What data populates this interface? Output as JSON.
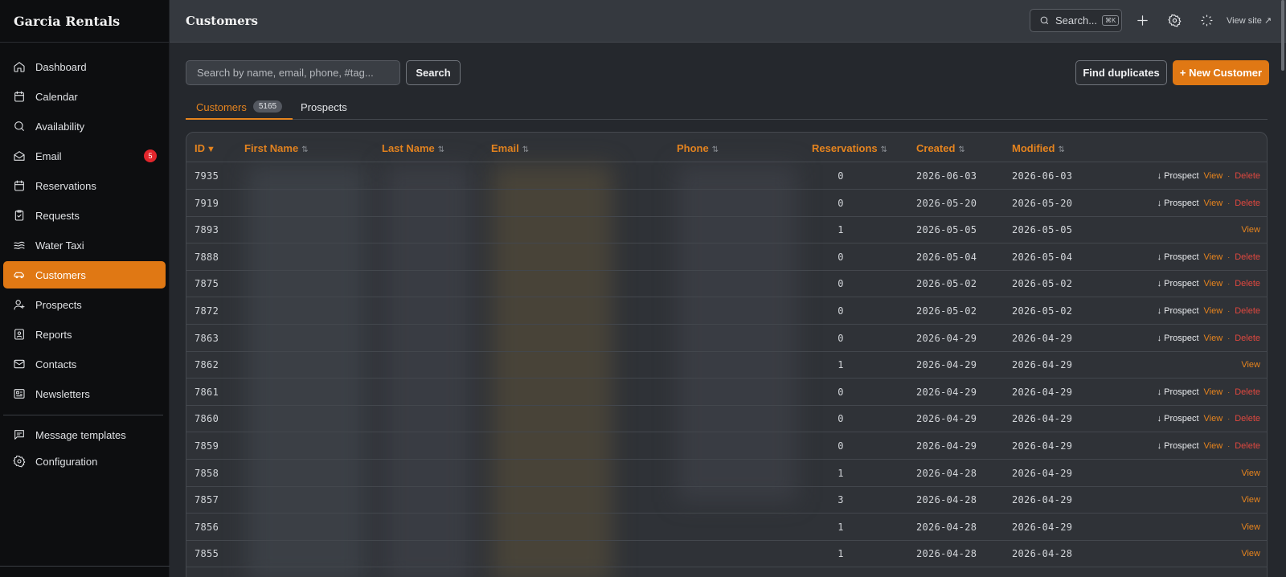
{
  "brand": "Garcia Rentals",
  "nav": {
    "items": [
      {
        "label": "Dashboard",
        "icon": "home-icon"
      },
      {
        "label": "Calendar",
        "icon": "calendar-icon"
      },
      {
        "label": "Availability",
        "icon": "search-icon"
      },
      {
        "label": "Email",
        "icon": "mail-open-icon",
        "badge": "5"
      },
      {
        "label": "Reservations",
        "icon": "calendar-icon"
      },
      {
        "label": "Requests",
        "icon": "clipboard-check-icon"
      },
      {
        "label": "Water Taxi",
        "icon": "waves-icon"
      },
      {
        "label": "Customers",
        "icon": "car-icon",
        "active": true
      },
      {
        "label": "Prospects",
        "icon": "user-plus-icon"
      },
      {
        "label": "Reports",
        "icon": "report-icon"
      },
      {
        "label": "Contacts",
        "icon": "mail-icon"
      },
      {
        "label": "Newsletters",
        "icon": "newspaper-icon"
      }
    ],
    "bottom_items": [
      {
        "label": "Message templates",
        "icon": "message-square-icon"
      },
      {
        "label": "Configuration",
        "icon": "gear-icon"
      }
    ]
  },
  "topbar": {
    "title": "Customers",
    "search_label": "Search...",
    "search_kbd": "⌘K",
    "view_site": "View site ↗"
  },
  "toolbar": {
    "search_placeholder": "Search by name, email, phone, #tag...",
    "search_button": "Search",
    "find_duplicates": "Find duplicates",
    "new_customer": "+ New Customer"
  },
  "tabs": [
    {
      "label": "Customers",
      "count": "5165",
      "active": true
    },
    {
      "label": "Prospects"
    }
  ],
  "table": {
    "columns": [
      "ID",
      "First Name",
      "Last Name",
      "Email",
      "Phone",
      "Reservations",
      "Created",
      "Modified"
    ],
    "sort_indicator": "▼",
    "action_labels": {
      "prospect": "↓ Prospect",
      "view": "View",
      "delete": "Delete",
      "separator": "·"
    },
    "rows": [
      {
        "id": "7935",
        "reservations": "0",
        "created": "2026-06-03",
        "modified": "2026-06-03",
        "full_actions": true
      },
      {
        "id": "7919",
        "reservations": "0",
        "created": "2026-05-20",
        "modified": "2026-05-20",
        "full_actions": true
      },
      {
        "id": "7893",
        "reservations": "1",
        "created": "2026-05-05",
        "modified": "2026-05-05",
        "full_actions": false
      },
      {
        "id": "7888",
        "reservations": "0",
        "created": "2026-05-04",
        "modified": "2026-05-04",
        "full_actions": true
      },
      {
        "id": "7875",
        "reservations": "0",
        "created": "2026-05-02",
        "modified": "2026-05-02",
        "full_actions": true
      },
      {
        "id": "7872",
        "reservations": "0",
        "created": "2026-05-02",
        "modified": "2026-05-02",
        "full_actions": true
      },
      {
        "id": "7863",
        "reservations": "0",
        "created": "2026-04-29",
        "modified": "2026-04-29",
        "full_actions": true
      },
      {
        "id": "7862",
        "reservations": "1",
        "created": "2026-04-29",
        "modified": "2026-04-29",
        "full_actions": false
      },
      {
        "id": "7861",
        "reservations": "0",
        "created": "2026-04-29",
        "modified": "2026-04-29",
        "full_actions": true
      },
      {
        "id": "7860",
        "reservations": "0",
        "created": "2026-04-29",
        "modified": "2026-04-29",
        "full_actions": true
      },
      {
        "id": "7859",
        "reservations": "0",
        "created": "2026-04-29",
        "modified": "2026-04-29",
        "full_actions": true
      },
      {
        "id": "7858",
        "reservations": "1",
        "created": "2026-04-28",
        "modified": "2026-04-29",
        "full_actions": false
      },
      {
        "id": "7857",
        "reservations": "3",
        "created": "2026-04-28",
        "modified": "2026-04-29",
        "full_actions": false
      },
      {
        "id": "7856",
        "reservations": "1",
        "created": "2026-04-28",
        "modified": "2026-04-29",
        "full_actions": false
      },
      {
        "id": "7855",
        "reservations": "1",
        "created": "2026-04-28",
        "modified": "2026-04-28",
        "full_actions": false
      }
    ]
  },
  "colors": {
    "accent": "#e07814",
    "danger": "#e0483f",
    "badge": "#e2262c"
  }
}
